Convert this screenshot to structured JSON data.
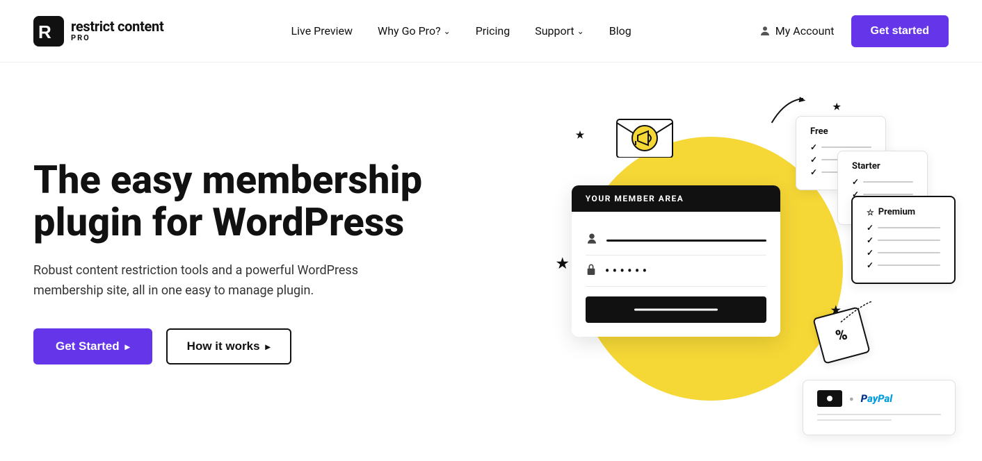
{
  "brand": {
    "name": "restrict content",
    "pro_badge": "PRO",
    "logo_letter": "R"
  },
  "nav": {
    "live_preview": "Live Preview",
    "why_go_pro": "Why Go Pro?",
    "pricing": "Pricing",
    "support": "Support",
    "blog": "Blog",
    "my_account": "My Account",
    "get_started": "Get started"
  },
  "hero": {
    "title": "The easy membership plugin for WordPress",
    "subtitle": "Robust content restriction tools and a powerful WordPress membership site, all in one easy to manage plugin.",
    "btn_primary": "Get Started",
    "btn_primary_arrow": "›",
    "btn_secondary": "How it works",
    "btn_secondary_arrow": "›"
  },
  "illustration": {
    "member_area_label": "YOUR MEMBER AREA",
    "member_password_dots": "••••••",
    "free_label": "Free",
    "starter_label": "Starter",
    "premium_label": "Premium",
    "paypal_label": "PayPal",
    "percent_label": "%"
  },
  "colors": {
    "accent": "#6535e9",
    "yellow": "#f5d736",
    "dark": "#111111"
  }
}
